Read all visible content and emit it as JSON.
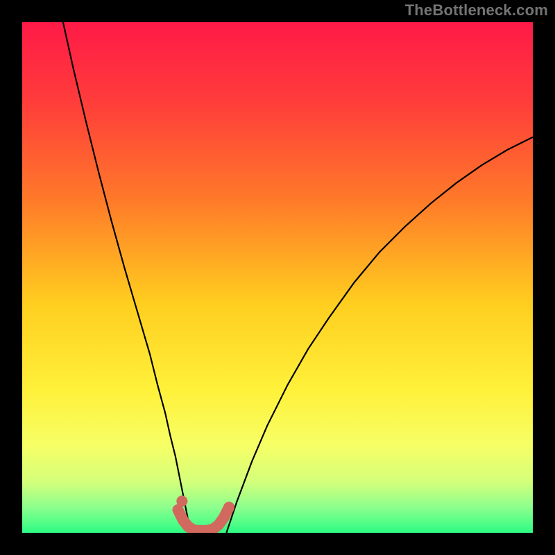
{
  "attribution": "TheBottleneck.com",
  "chart_data": {
    "type": "line",
    "title": "",
    "xlabel": "",
    "ylabel": "",
    "xlim": [
      0,
      100
    ],
    "ylim": [
      0,
      100
    ],
    "gradient_stops": [
      {
        "offset": 0.0,
        "color": "#ff1a47"
      },
      {
        "offset": 0.15,
        "color": "#ff3b3b"
      },
      {
        "offset": 0.35,
        "color": "#ff7a29"
      },
      {
        "offset": 0.55,
        "color": "#ffce1f"
      },
      {
        "offset": 0.72,
        "color": "#fff13a"
      },
      {
        "offset": 0.83,
        "color": "#f6ff66"
      },
      {
        "offset": 0.9,
        "color": "#d4ff7a"
      },
      {
        "offset": 0.95,
        "color": "#8dff8d"
      },
      {
        "offset": 1.0,
        "color": "#2dfc84"
      }
    ],
    "series": [
      {
        "name": "left-curve",
        "x": [
          8.0,
          10.0,
          12.5,
          15.0,
          17.5,
          20.0,
          22.5,
          25.0,
          26.5,
          28.0,
          29.0,
          30.0,
          30.8,
          31.5,
          32.2,
          33.0
        ],
        "values": [
          100.0,
          91.0,
          80.5,
          70.5,
          61.0,
          52.0,
          43.5,
          35.0,
          29.0,
          23.5,
          19.0,
          15.0,
          11.0,
          7.5,
          4.0,
          0.0
        ]
      },
      {
        "name": "right-curve",
        "x": [
          40.0,
          42.0,
          45.0,
          48.0,
          52.0,
          56.0,
          60.0,
          65.0,
          70.0,
          75.0,
          80.0,
          85.0,
          90.0,
          95.0,
          100.0
        ],
        "values": [
          0.0,
          6.0,
          14.0,
          21.0,
          29.0,
          36.0,
          42.0,
          49.0,
          55.0,
          60.0,
          64.5,
          68.5,
          72.0,
          75.0,
          77.5
        ]
      },
      {
        "name": "valley-marker",
        "x": [
          30.5,
          31.5,
          32.5,
          33.5,
          34.5,
          35.5,
          36.5,
          37.5,
          38.5,
          39.5,
          40.5
        ],
        "values": [
          4.5,
          2.5,
          1.2,
          0.6,
          0.4,
          0.4,
          0.5,
          0.8,
          1.6,
          3.0,
          5.0
        ]
      },
      {
        "name": "valley-dot",
        "x": [
          31.3
        ],
        "values": [
          6.2
        ]
      }
    ],
    "styles": {
      "left-curve": {
        "stroke": "#000000",
        "stroke_width": 2.2,
        "markers": false
      },
      "right-curve": {
        "stroke": "#000000",
        "stroke_width": 2.2,
        "markers": false
      },
      "valley-marker": {
        "stroke": "#d1695e",
        "stroke_width": 16,
        "markers": false,
        "linecap": "round"
      },
      "valley-dot": {
        "stroke": "#d1695e",
        "fill": "#d1695e",
        "radius": 8,
        "markers": true
      }
    }
  }
}
